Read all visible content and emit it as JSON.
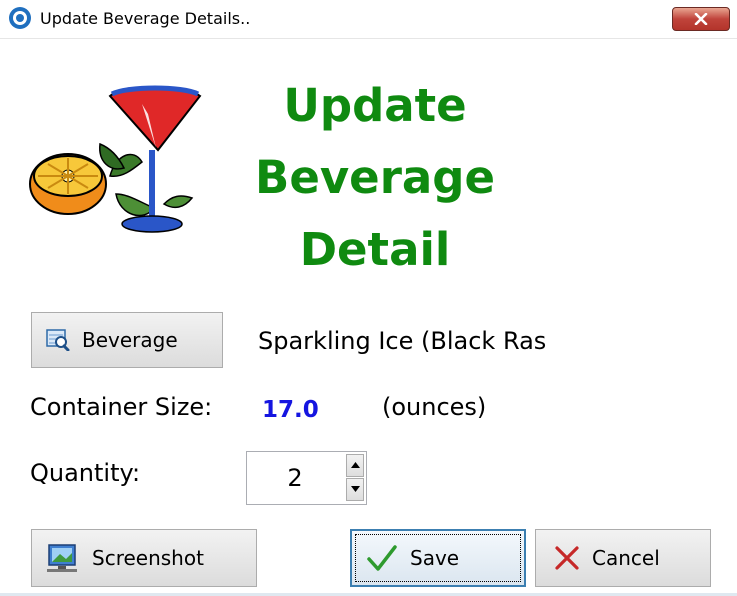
{
  "window": {
    "title": "Update Beverage Details..",
    "close_icon": "close-x-icon"
  },
  "heading": {
    "line1": "Update",
    "line2": "Beverage",
    "line3": "Detail"
  },
  "colors": {
    "heading": "#0f8a10",
    "size_value": "#1515e0",
    "close_button": "#c0443b"
  },
  "beverage": {
    "button_label": "Beverage",
    "button_icon": "search-database-icon",
    "name": "Sparkling Ice (Black Ras"
  },
  "container": {
    "label": "Container Size:",
    "value": "17.0",
    "unit": "(ounces)"
  },
  "quantity": {
    "label": "Quantity:",
    "value": "2"
  },
  "buttons": {
    "screenshot": "Screenshot",
    "save": "Save",
    "cancel": "Cancel"
  }
}
